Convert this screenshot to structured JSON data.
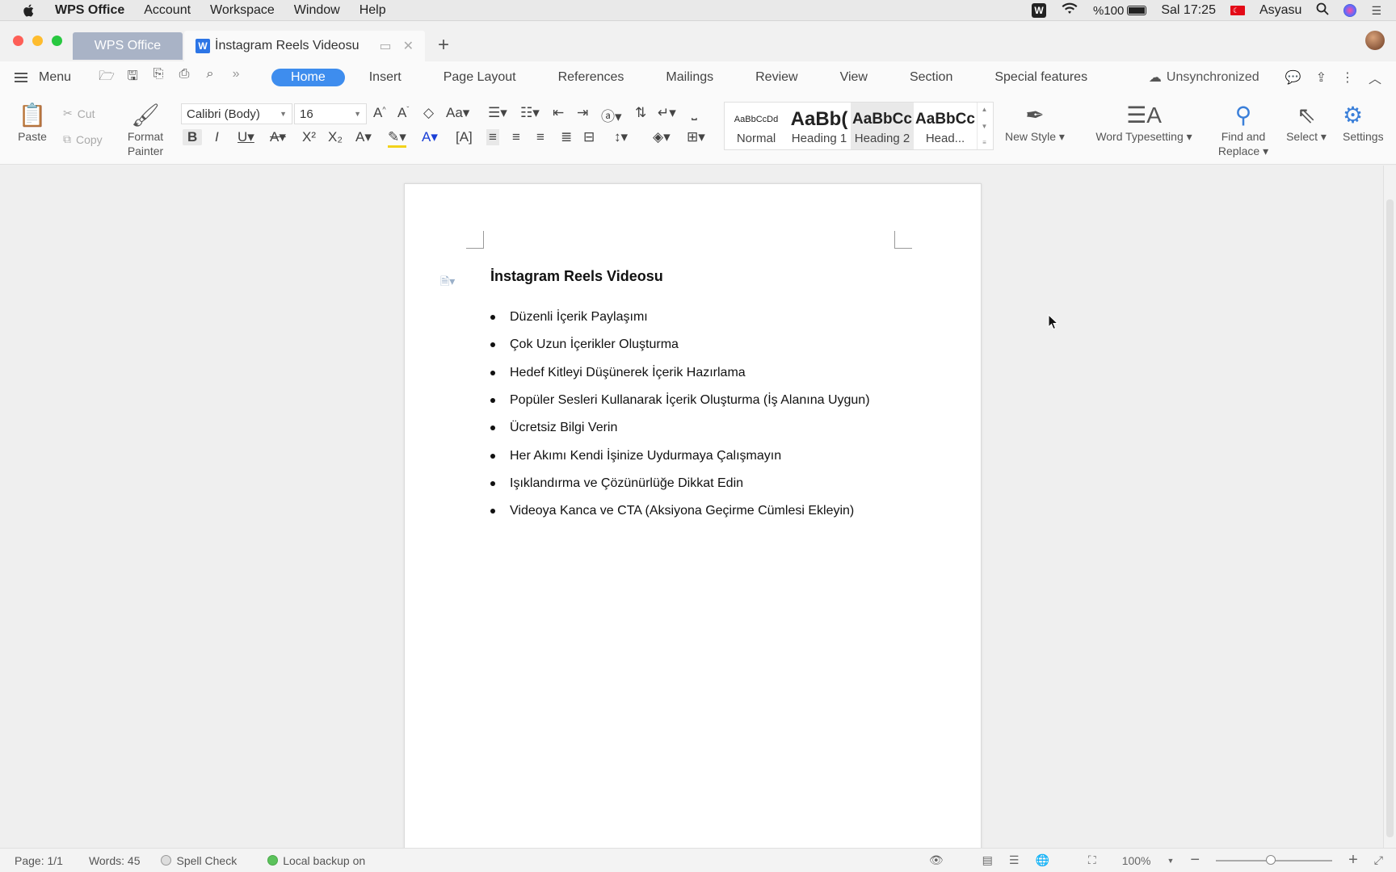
{
  "menubar": {
    "items": [
      "WPS Office",
      "Account",
      "Workspace",
      "Window",
      "Help"
    ],
    "battery": "%100",
    "clock": "Sal 17:25",
    "user": "Asyasu"
  },
  "tabs": {
    "home_tab": "WPS Office",
    "doc_tab": "İnstagram Reels Videosu"
  },
  "ribbon": {
    "menu_label": "Menu",
    "tabs": [
      "Home",
      "Insert",
      "Page Layout",
      "References",
      "Mailings",
      "Review",
      "View",
      "Section",
      "Special features"
    ],
    "sync_status": "Unsynchronized"
  },
  "toolbar": {
    "paste": "Paste",
    "cut": "Cut",
    "copy": "Copy",
    "format_painter_1": "Format",
    "format_painter_2": "Painter",
    "font_name": "Calibri (Body)",
    "font_size": "16",
    "styles": [
      {
        "sample": "AaBbCcDd",
        "name": "Normal"
      },
      {
        "sample": "AaBb(",
        "name": "Heading 1"
      },
      {
        "sample": "AaBbCc",
        "name": "Heading 2"
      },
      {
        "sample": "AaBbCc",
        "name": "Head..."
      }
    ],
    "new_style": "New Style",
    "word_typesetting": "Word Typesetting",
    "find_replace_1": "Find and",
    "find_replace_2": "Replace",
    "select": "Select",
    "settings": "Settings"
  },
  "document": {
    "title": "İnstagram Reels Videosu",
    "bullets": [
      "Düzenli İçerik Paylaşımı",
      "Çok Uzun İçerikler Oluşturma",
      "Hedef Kitleyi Düşünerek İçerik Hazırlama",
      "Popüler Sesleri Kullanarak İçerik Oluşturma (İş Alanına Uygun)",
      "Ücretsiz Bilgi Verin",
      "Her Akımı Kendi İşinize Uydurmaya Çalışmayın",
      "Işıklandırma ve Çözünürlüğe Dikkat Edin",
      "Videoya Kanca ve CTA (Aksiyona Geçirme Cümlesi Ekleyin)"
    ]
  },
  "status": {
    "page": "Page: 1/1",
    "words": "Words: 45",
    "spell_check": "Spell Check",
    "backup": "Local backup on",
    "zoom": "100%",
    "zoom_level": 0.47
  }
}
